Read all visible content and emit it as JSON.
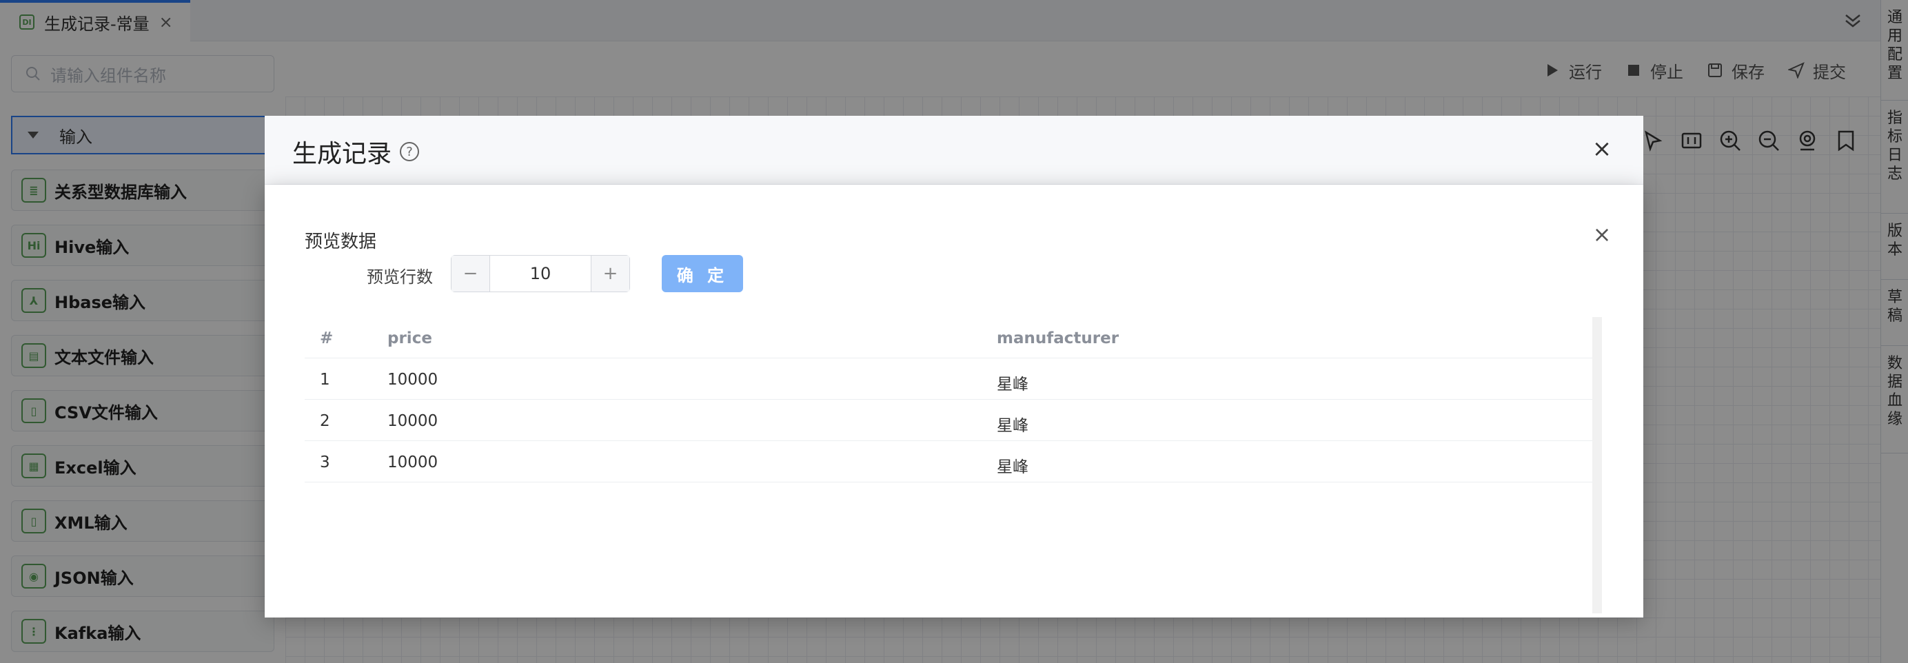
{
  "tab": {
    "label": "生成记录-常量",
    "icon": "DI"
  },
  "right_panel": {
    "items": [
      "通用配置",
      "指标日志",
      "版本",
      "草稿",
      "数据血缘"
    ]
  },
  "toolbar": {
    "run": "运行",
    "stop": "停止",
    "save": "保存",
    "submit": "提交"
  },
  "left_panel": {
    "search_placeholder": "请输入组件名称",
    "group_label": "输入",
    "components": [
      {
        "label": "关系型数据库输入",
        "icon": "database-icon",
        "glyph": "≣"
      },
      {
        "label": "Hive输入",
        "icon": "hive-icon",
        "glyph": "Hi"
      },
      {
        "label": "Hbase输入",
        "icon": "hbase-icon",
        "glyph": "⅄"
      },
      {
        "label": "文本文件输入",
        "icon": "text-file-icon",
        "glyph": "▤"
      },
      {
        "label": "CSV文件输入",
        "icon": "csv-file-icon",
        "glyph": "▯"
      },
      {
        "label": "Excel输入",
        "icon": "excel-icon",
        "glyph": "▦"
      },
      {
        "label": "XML输入",
        "icon": "xml-file-icon",
        "glyph": "▯"
      },
      {
        "label": "JSON输入",
        "icon": "json-icon",
        "glyph": "◉"
      },
      {
        "label": "Kafka输入",
        "icon": "kafka-icon",
        "glyph": "⋮"
      }
    ]
  },
  "modal": {
    "title": "生成记录",
    "preview_title": "预览数据",
    "rows_label": "预览行数",
    "rows_value": "10",
    "confirm_label": "确 定",
    "table": {
      "columns": [
        "#",
        "price",
        "manufacturer"
      ],
      "rows": [
        [
          "1",
          "10000",
          "星峰"
        ],
        [
          "2",
          "10000",
          "星峰"
        ],
        [
          "3",
          "10000",
          "星峰"
        ]
      ]
    }
  },
  "colors": {
    "accent": "#2f7df6",
    "component_icon": "#5aa35a",
    "confirm": "#7fb3f8"
  }
}
